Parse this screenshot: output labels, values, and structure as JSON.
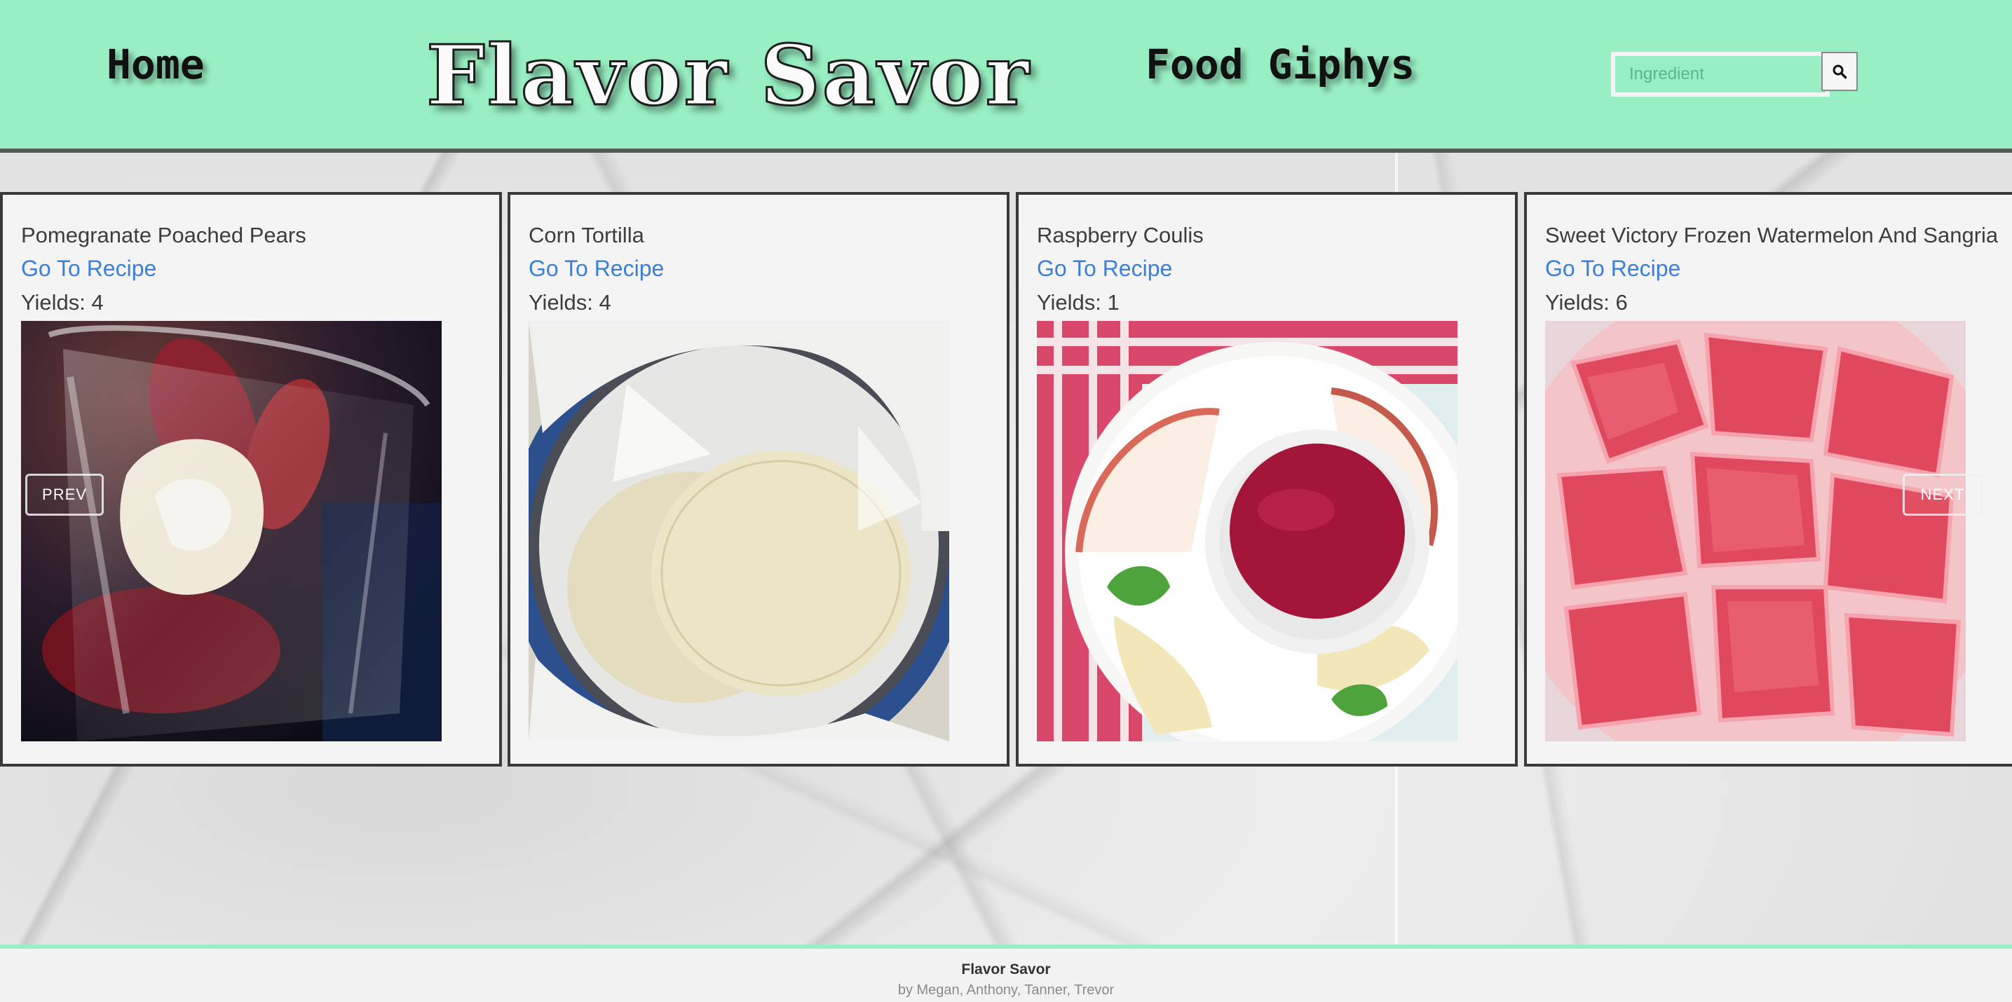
{
  "header": {
    "nav_home": "Home",
    "brand": "Flavor Savor",
    "nav_giphys": "Food Giphys",
    "search": {
      "placeholder": "Ingredient",
      "value": "",
      "button_icon": "search-icon"
    }
  },
  "carousel": {
    "prev_label": "PREV",
    "next_label": "NEXT",
    "cards": [
      {
        "title": "Pomegranate Poached Pears",
        "link_label": "Go To Recipe",
        "yields": "Yields: 4",
        "image_subject": "pear-dessert-image"
      },
      {
        "title": "Corn Tortilla",
        "link_label": "Go To Recipe",
        "yields": "Yields: 4",
        "image_subject": "tortilla-image"
      },
      {
        "title": "Raspberry Coulis",
        "link_label": "Go To Recipe",
        "yields": "Yields: 1",
        "image_subject": "raspberry-coulis-image"
      },
      {
        "title": "Sweet Victory Frozen Watermelon And Sangria",
        "link_label": "Go To Recipe",
        "yields": "Yields: 6",
        "image_subject": "watermelon-image"
      }
    ]
  },
  "footer": {
    "title": "Flavor Savor",
    "credits": "by Megan, Anthony, Tanner, Trevor"
  },
  "colors": {
    "header_bg": "#98efc2",
    "link": "#3b7fd8",
    "card_border": "#3a3a3a",
    "footer_accent": "#98efc2"
  }
}
